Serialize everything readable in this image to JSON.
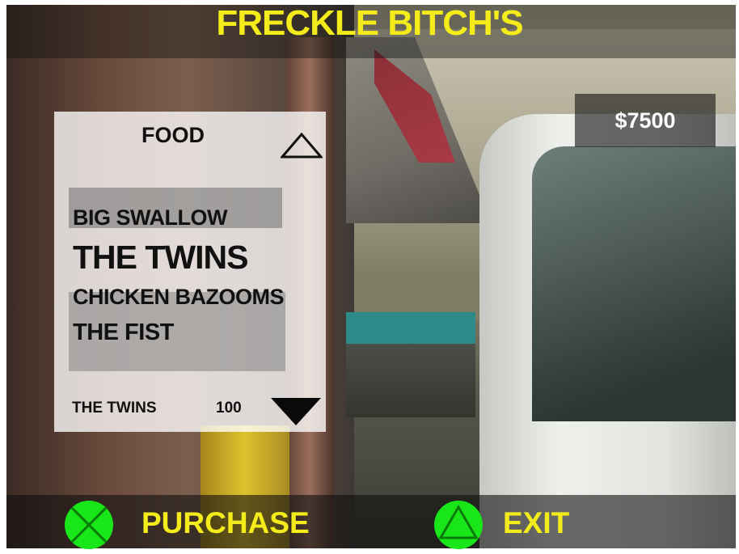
{
  "header": {
    "title": "FRECKLE BITCH'S"
  },
  "wallet": {
    "money": "$7500"
  },
  "menu": {
    "category": "FOOD",
    "items": [
      "BIG SWALLOW",
      "THE TWINS",
      "CHICKEN BAZOOMS",
      "THE FIST"
    ],
    "selected": {
      "name": "THE TWINS",
      "price": "100"
    }
  },
  "prompts": {
    "purchase": {
      "label": "PURCHASE",
      "button_icon": "cross-button-icon"
    },
    "exit": {
      "label": "EXIT",
      "button_icon": "triangle-button-icon"
    }
  },
  "colors": {
    "title": "#f4ec1a",
    "prompt_text": "#f4ec1a",
    "prompt_button": "#19e619",
    "panel_text": "#111111",
    "money_text": "#ffffff"
  }
}
